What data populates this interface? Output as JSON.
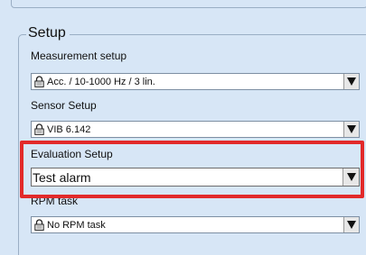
{
  "panel": {
    "title": "Setup"
  },
  "fields": [
    {
      "label": "Measurement setup",
      "value": "Acc. / 10-1000 Hz / 3 lin.",
      "locked": true,
      "icon": "padlock-icon"
    },
    {
      "label": "Sensor Setup",
      "value": "VIB 6.142",
      "locked": true,
      "icon": "padlock-icon"
    },
    {
      "label": "Evaluation Setup",
      "value": "Test alarm",
      "locked": false,
      "highlighted": true
    },
    {
      "label": "RPM task",
      "value": "No RPM task",
      "locked": true,
      "icon": "padlock-icon"
    }
  ],
  "colors": {
    "background": "#d7e6f6",
    "highlight": "#e22a2a",
    "select_bg": "#ffffff"
  },
  "icons": {
    "dropdown": "dropdown-arrow-icon",
    "lock": "padlock-icon"
  }
}
